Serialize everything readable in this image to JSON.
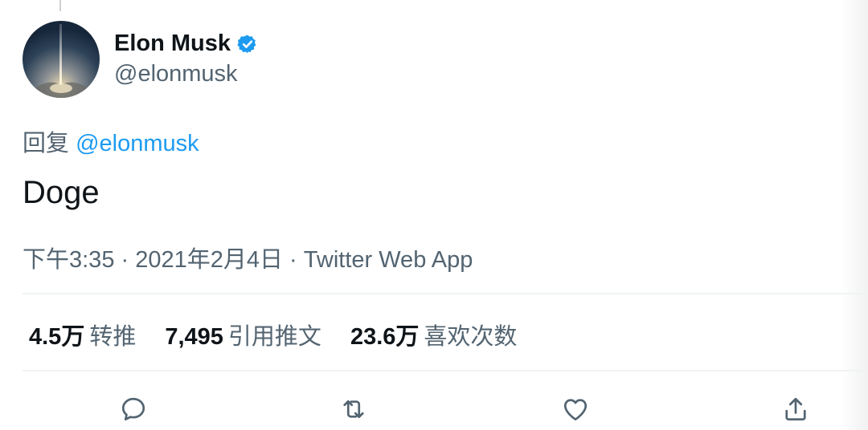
{
  "tweet": {
    "author": {
      "display_name": "Elon Musk",
      "handle": "@elonmusk",
      "verified": true,
      "avatar_icon": "rocket-launch-avatar-icon"
    },
    "reply_prefix": "回复",
    "reply_to": "@elonmusk",
    "text": "Doge",
    "meta": "下午3:35 · 2021年2月4日 · Twitter Web App",
    "stats": [
      {
        "value": "4.5万",
        "label": "转推"
      },
      {
        "value": "7,495",
        "label": "引用推文"
      },
      {
        "value": "23.6万",
        "label": "喜欢次数"
      }
    ],
    "actions": [
      "reply-icon",
      "retweet-icon",
      "like-icon",
      "share-icon"
    ]
  },
  "colors": {
    "accent": "#1d9bf0",
    "text_primary": "#0f1419",
    "text_secondary": "#536471",
    "divider": "#eff3f4"
  }
}
